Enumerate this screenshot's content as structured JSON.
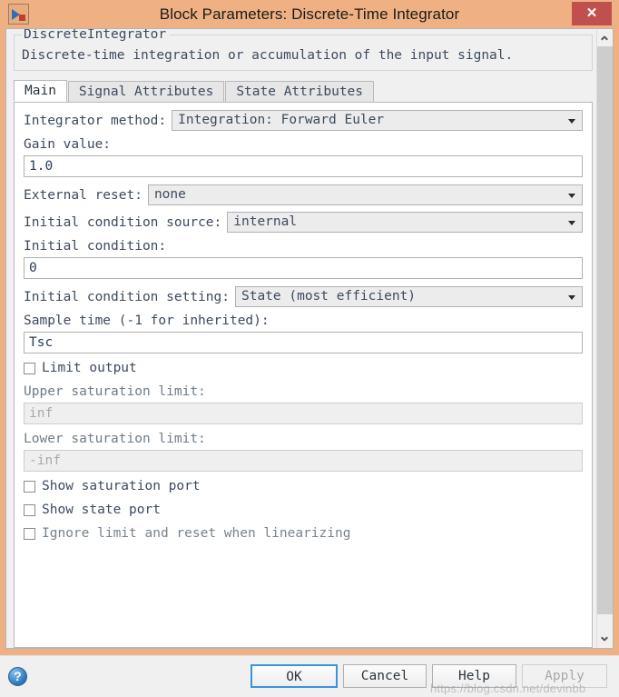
{
  "window": {
    "title": "Block Parameters: Discrete-Time Integrator",
    "close_label": "✕",
    "icon": "simulink-block-icon",
    "titlebar_color": "#efb183",
    "close_color": "#c0504d"
  },
  "description": {
    "block_name": "DiscreteIntegrator",
    "text": "Discrete-time integration or accumulation of the input signal."
  },
  "tabs": [
    {
      "label": "Main",
      "active": true
    },
    {
      "label": "Signal Attributes",
      "active": false
    },
    {
      "label": "State Attributes",
      "active": false
    }
  ],
  "form": {
    "integrator_method": {
      "label": "Integrator method:",
      "value": "Integration: Forward Euler"
    },
    "gain_value": {
      "label": "Gain value:",
      "value": "1.0"
    },
    "external_reset": {
      "label": "External reset:",
      "value": "none"
    },
    "initial_condition_source": {
      "label": "Initial condition source:",
      "value": "internal"
    },
    "initial_condition": {
      "label": "Initial condition:",
      "value": "0"
    },
    "initial_condition_setting": {
      "label": "Initial condition setting:",
      "value": "State (most efficient)"
    },
    "sample_time": {
      "label": "Sample time (-1 for inherited):",
      "value": "Tsc"
    },
    "limit_output": {
      "label": "Limit output",
      "checked": false
    },
    "upper_saturation_limit": {
      "label": "Upper saturation limit:",
      "value": "inf",
      "disabled": true
    },
    "lower_saturation_limit": {
      "label": "Lower saturation limit:",
      "value": "-inf",
      "disabled": true
    },
    "show_saturation_port": {
      "label": "Show saturation port",
      "checked": false
    },
    "show_state_port": {
      "label": "Show state port",
      "checked": false
    },
    "ignore_limit_and_reset": {
      "label": "Ignore limit and reset when linearizing",
      "checked": false,
      "disabled": true
    }
  },
  "buttons": {
    "help_icon": "?",
    "ok": "OK",
    "cancel": "Cancel",
    "help": "Help",
    "apply": "Apply",
    "apply_disabled": true
  },
  "watermark": "https://blog.csdn.net/devinbb"
}
